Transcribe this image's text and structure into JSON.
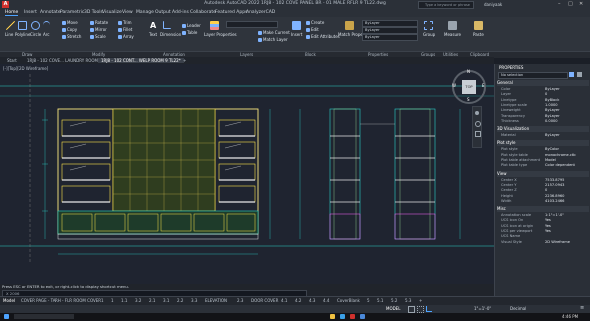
{
  "window": {
    "title": "Autodesk AutoCAD 2022   1RJ8 - 102 COVE PANEL BR - 01 MALE RFLR 9 TL22.dwg",
    "search_placeholder": "Type a keyword or phrase",
    "user": "daniyaak"
  },
  "ribbon_tabs": [
    "Home",
    "Insert",
    "Annotate",
    "Parametric",
    "3D Tools",
    "Visualize",
    "View",
    "Manage",
    "Output",
    "Add-ins",
    "Collaborate",
    "Featured Apps",
    "AnalyzerCAD"
  ],
  "ribbon": {
    "draw_tools": [
      "Line",
      "Polyline",
      "Circle",
      "Arc"
    ],
    "modify_tools": [
      [
        "Move",
        "Rotate",
        "Trim",
        "Fillet"
      ],
      [
        "Copy",
        "Mirror",
        "Extend",
        "Array"
      ],
      [
        "Stretch",
        "Scale",
        "Explode",
        "Offset"
      ]
    ],
    "annotation_tools": [
      "Text",
      "Dimension",
      "Leader",
      "Table"
    ],
    "layer_tools": [
      "Layer Properties",
      "Make Current",
      "Match Layer"
    ],
    "block_tools": [
      "Insert",
      "Create",
      "Edit",
      "Edit Attributes"
    ],
    "properties_tools": [
      "Match Properties",
      "ByLayer",
      "ByLayer",
      "ByLayer"
    ],
    "groups_label": "Group",
    "utilities_label": "Measure",
    "clipboard_label": "Paste",
    "panels": [
      "Draw",
      "Modify",
      "Annotation",
      "Layers",
      "Block",
      "Properties",
      "Groups",
      "Utilities",
      "Clipboard"
    ]
  },
  "doc_tabs": [
    "Start",
    "1RJ8 - 102 COVE... LAUNDRY ROOM*",
    "1RJ8 - 102 CONT... WELP ROOM 9 TL22*"
  ],
  "viewport_label": "[-][Top][2D Wireframe]",
  "compass": {
    "n": "N",
    "s": "S",
    "e": "E",
    "w": "W",
    "top": "TOP"
  },
  "properties": {
    "title": "PROPERTIES",
    "selection": "No selection",
    "sections": [
      {
        "name": "General",
        "rows": [
          [
            "Color",
            "ByLayer"
          ],
          [
            "Layer",
            "0"
          ],
          [
            "Linetype",
            "ByBlock"
          ],
          [
            "Linetype scale",
            "1.0000"
          ],
          [
            "Lineweight",
            "ByLayer"
          ],
          [
            "Transparency",
            "ByLayer"
          ],
          [
            "Thickness",
            "0.0000"
          ]
        ]
      },
      {
        "name": "3D Visualization",
        "rows": [
          [
            "Material",
            "ByLayer"
          ]
        ]
      },
      {
        "name": "Plot style",
        "rows": [
          [
            "Plot style",
            "ByColor"
          ],
          [
            "Plot style table",
            "monochrome.ctb"
          ],
          [
            "Plot table attachment",
            "Model"
          ],
          [
            "Plot table type",
            "Color dependent"
          ]
        ]
      },
      {
        "name": "View",
        "rows": [
          [
            "Center X",
            "7533.8795"
          ],
          [
            "Center Y",
            "2157.0943"
          ],
          [
            "Center Z",
            "0"
          ],
          [
            "Height",
            "2236.8960"
          ],
          [
            "Width",
            "4103.2466"
          ]
        ]
      },
      {
        "name": "Misc",
        "rows": [
          [
            "Annotation scale",
            "1:1\"=1'-0\""
          ],
          [
            "UCS icon On",
            "Yes"
          ],
          [
            "UCS icon at origin",
            "Yes"
          ],
          [
            "UCS per viewport",
            "Yes"
          ],
          [
            "UCS Name",
            ""
          ],
          [
            "Visual Style",
            "2D Wireframe"
          ]
        ]
      }
    ]
  },
  "command": {
    "history": "Press ESC or ENTER to exit, or right-click to display shortcut menu.",
    "prompt": "X  2006"
  },
  "layout_tabs": [
    "Model",
    "COVER PAGE - TA",
    "RH - FLR ROOM COVER",
    "1",
    "1",
    "1.1",
    "3.2",
    "2.1",
    "3.1",
    "2.2",
    "3.3",
    "ELEVATION",
    "2.3",
    "DOOR COVER",
    "4.1",
    "4.2",
    "4.3",
    "4.4",
    "CoverBlank",
    "5",
    "5.1",
    "5.2",
    "5.3"
  ],
  "status": {
    "model": "MODEL",
    "scale": "1\"=1'-0\"",
    "units": "Decimal"
  },
  "clock": "4:46 PM"
}
